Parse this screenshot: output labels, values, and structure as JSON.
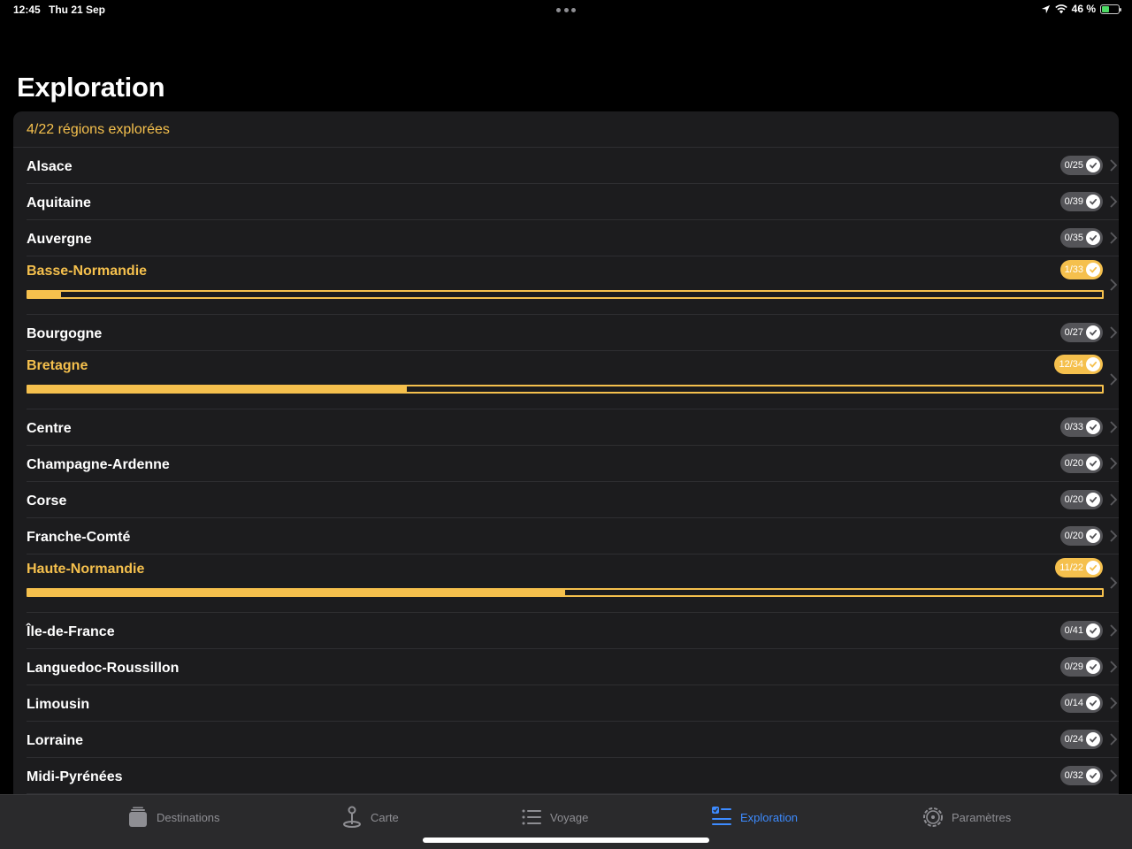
{
  "status_bar": {
    "time": "12:45",
    "date": "Thu 21 Sep",
    "battery": "46 %",
    "battery_level": 0.46
  },
  "page": {
    "title": "Exploration",
    "summary": "4/22 régions explorées"
  },
  "colors": {
    "accent": "#f5c04d",
    "tab_active": "#3d8bff",
    "card": "#1c1c1e"
  },
  "regions": [
    {
      "name": "Alsace",
      "count": "0/25",
      "progress": 0
    },
    {
      "name": "Aquitaine",
      "count": "0/39",
      "progress": 0
    },
    {
      "name": "Auvergne",
      "count": "0/35",
      "progress": 0
    },
    {
      "name": "Basse-Normandie",
      "count": "1/33",
      "progress": 0.0303
    },
    {
      "name": "Bourgogne",
      "count": "0/27",
      "progress": 0
    },
    {
      "name": "Bretagne",
      "count": "12/34",
      "progress": 0.3529
    },
    {
      "name": "Centre",
      "count": "0/33",
      "progress": 0
    },
    {
      "name": "Champagne-Ardenne",
      "count": "0/20",
      "progress": 0
    },
    {
      "name": "Corse",
      "count": "0/20",
      "progress": 0
    },
    {
      "name": "Franche-Comté",
      "count": "0/20",
      "progress": 0
    },
    {
      "name": "Haute-Normandie",
      "count": "11/22",
      "progress": 0.5
    },
    {
      "name": "Île-de-France",
      "count": "0/41",
      "progress": 0
    },
    {
      "name": "Languedoc-Roussillon",
      "count": "0/29",
      "progress": 0
    },
    {
      "name": "Limousin",
      "count": "0/14",
      "progress": 0
    },
    {
      "name": "Lorraine",
      "count": "0/24",
      "progress": 0
    },
    {
      "name": "Midi-Pyrénées",
      "count": "0/32",
      "progress": 0
    }
  ],
  "tabs": [
    {
      "label": "Destinations",
      "icon": "stack-icon",
      "active": false
    },
    {
      "label": "Carte",
      "icon": "map-pin-icon",
      "active": false
    },
    {
      "label": "Voyage",
      "icon": "list-icon",
      "active": false
    },
    {
      "label": "Exploration",
      "icon": "checklist-icon",
      "active": true
    },
    {
      "label": "Paramètres",
      "icon": "gear-icon",
      "active": false
    }
  ]
}
